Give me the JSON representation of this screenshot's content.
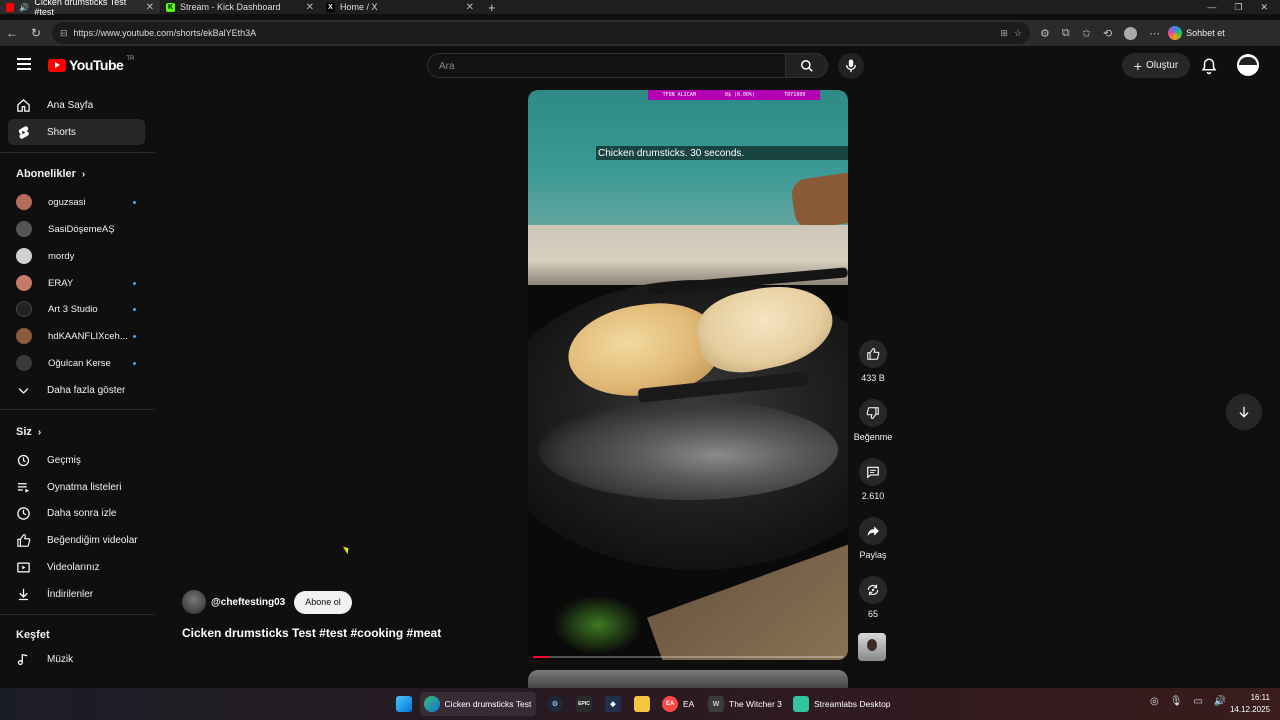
{
  "browser": {
    "tabs": [
      {
        "title": "Cicken drumsticks Test #test",
        "active": true
      },
      {
        "title": "Stream - Kick Dashboard",
        "active": false
      },
      {
        "title": "Home / X",
        "active": false
      }
    ],
    "url": "https://www.youtube.com/shorts/ekBalYEth3A",
    "copilot_label": "Sohbet et"
  },
  "masthead": {
    "logo_text": "YouTube",
    "country_code": "TR",
    "search_placeholder": "Ara",
    "create_label": "Oluştur"
  },
  "sidebar": {
    "main": [
      {
        "label": "Ana Sayfa",
        "icon": "home-icon"
      },
      {
        "label": "Shorts",
        "icon": "shorts-icon",
        "active": true
      }
    ],
    "subscriptions_title": "Abonelikler",
    "subscriptions": [
      {
        "name": "oguzsasi",
        "dot": true,
        "color": "#b36b5a"
      },
      {
        "name": "SasiDöşemeAŞ",
        "dot": false,
        "color": "#555555"
      },
      {
        "name": "mordy",
        "dot": false,
        "color": "#cfcfcf"
      },
      {
        "name": "ERAY",
        "dot": true,
        "color": "#c87a6a"
      },
      {
        "name": "Art 3 Studio",
        "dot": true,
        "color": "#222222"
      },
      {
        "name": "hdKAANFLIXceh...",
        "dot": true,
        "color": "#8a5a3a"
      },
      {
        "name": "Oğulcan Kerse",
        "dot": true,
        "color": "#3a3a3a"
      }
    ],
    "show_more": "Daha fazla göster",
    "you_title": "Siz",
    "you": [
      {
        "label": "Geçmiş",
        "icon": "history-icon"
      },
      {
        "label": "Oynatma listeleri",
        "icon": "playlists-icon"
      },
      {
        "label": "Daha sonra izle",
        "icon": "watch-later-icon"
      },
      {
        "label": "Beğendiğim videolar",
        "icon": "liked-icon"
      },
      {
        "label": "Videolarınız",
        "icon": "your-videos-icon"
      },
      {
        "label": "İndirilenler",
        "icon": "downloads-icon"
      }
    ],
    "explore_title": "Keşfet",
    "explore": [
      {
        "label": "Müzik",
        "icon": "music-icon"
      }
    ]
  },
  "short": {
    "caption": "Chicken drumsticks. 30 seconds.",
    "banner_left": "TFON ALICAM",
    "banner_mid": "0$ (0.00%)",
    "banner_right": "TRY1000",
    "progress": 0.05,
    "channel": "@cheftesting03",
    "subscribe_label": "Abone ol",
    "title": "Cicken drumsticks Test #test #cooking #meat",
    "actions": {
      "like_count": "433 B",
      "dislike_label": "Beğenme",
      "comment_count": "2.610",
      "share_label": "Paylaş",
      "remix_count": "65"
    }
  },
  "taskbar": {
    "items": [
      {
        "label": "Cicken drumsticks Test ı",
        "icon": "edge-icon"
      },
      {
        "label": "EA",
        "icon": "ea-icon"
      },
      {
        "label": "The Witcher 3",
        "icon": "witcher-icon"
      },
      {
        "label": "Streamlabs Desktop",
        "icon": "streamlabs-icon"
      }
    ],
    "time": "16:11",
    "date": "14.12.2025"
  },
  "colors": {
    "yt_red": "#ff0000",
    "background": "#0f0f0f",
    "sidebar_active": "#272727",
    "dot_blue": "#3ea6ff"
  }
}
